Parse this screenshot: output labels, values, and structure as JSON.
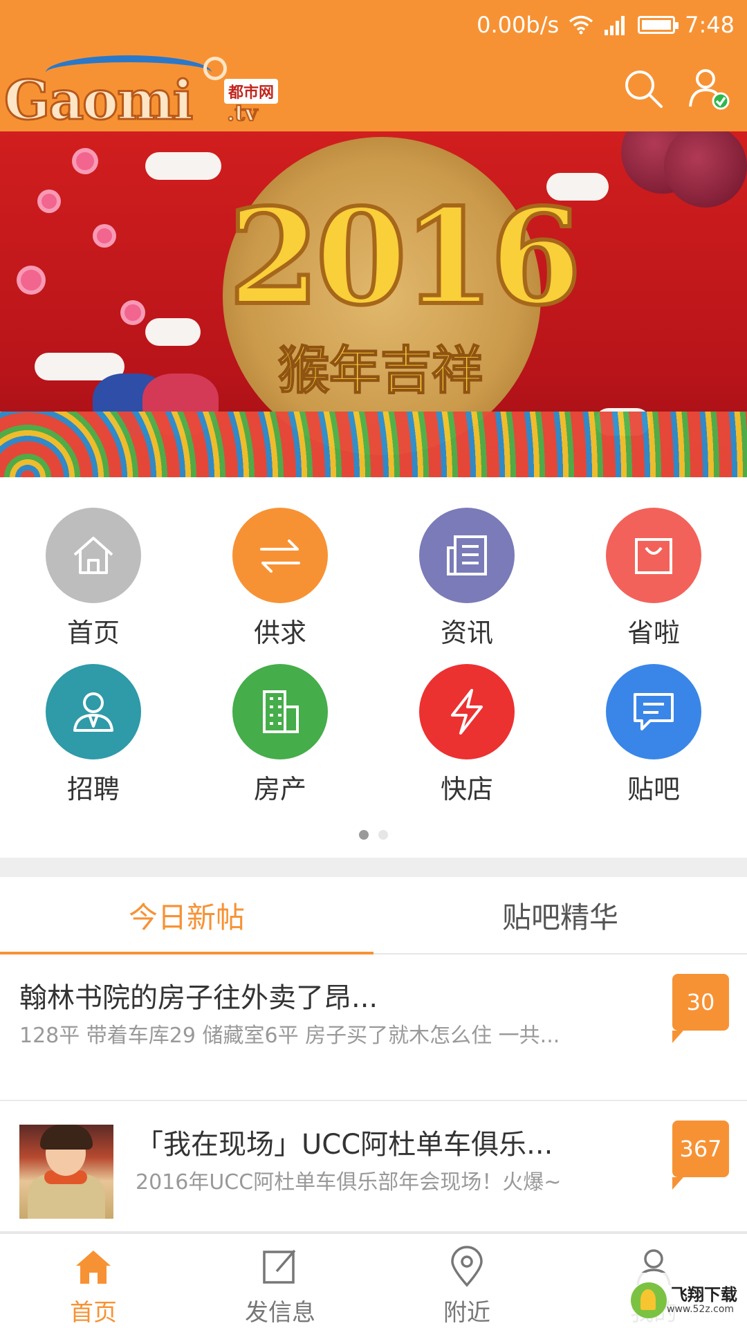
{
  "status_bar": {
    "speed": "0.00b/s",
    "time": "7:48"
  },
  "header": {
    "logo_word": "Gaomi",
    "logo_badge": "都市网",
    "logo_tld": ".tv"
  },
  "banner": {
    "year": "2016",
    "slogan": "猴年吉祥"
  },
  "grid": {
    "items": [
      {
        "label": "首页",
        "icon": "home-icon",
        "color": "#bdbdbd"
      },
      {
        "label": "供求",
        "icon": "exchange-icon",
        "color": "#f79234"
      },
      {
        "label": "资讯",
        "icon": "news-icon",
        "color": "#7a7bb8"
      },
      {
        "label": "省啦",
        "icon": "shopping-bag-icon",
        "color": "#f2625a"
      },
      {
        "label": "招聘",
        "icon": "person-icon",
        "color": "#2f9aa8"
      },
      {
        "label": "房产",
        "icon": "building-icon",
        "color": "#45ad4a"
      },
      {
        "label": "快店",
        "icon": "lightning-icon",
        "color": "#ec3131"
      },
      {
        "label": "贴吧",
        "icon": "chat-icon",
        "color": "#3a86e8"
      }
    ],
    "page_count": 2,
    "current_page": 1
  },
  "tabs": [
    {
      "label": "今日新帖",
      "active": true
    },
    {
      "label": "贴吧精华",
      "active": false
    }
  ],
  "posts": [
    {
      "title": "翰林书院的房子往外卖了昂...",
      "desc": "128平 带着车库29 储藏室6平 房子买了就木怎么住 一共...",
      "count": "30"
    },
    {
      "title": "「我在现场」UCC阿杜单车俱乐...",
      "desc": "2016年UCC阿杜单车俱乐部年会现场！火爆~",
      "count": "367"
    }
  ],
  "bottom_nav": [
    {
      "label": "首页",
      "icon": "home-icon",
      "active": true
    },
    {
      "label": "发信息",
      "icon": "compose-icon",
      "active": false
    },
    {
      "label": "附近",
      "icon": "location-pin-icon",
      "active": false
    },
    {
      "label": "我的",
      "icon": "user-icon",
      "active": false
    }
  ],
  "watermark": {
    "title": "飞翔下载",
    "url": "www.52z.com"
  },
  "colors": {
    "brand": "#f79234",
    "text": "#333333",
    "muted": "#999999"
  }
}
